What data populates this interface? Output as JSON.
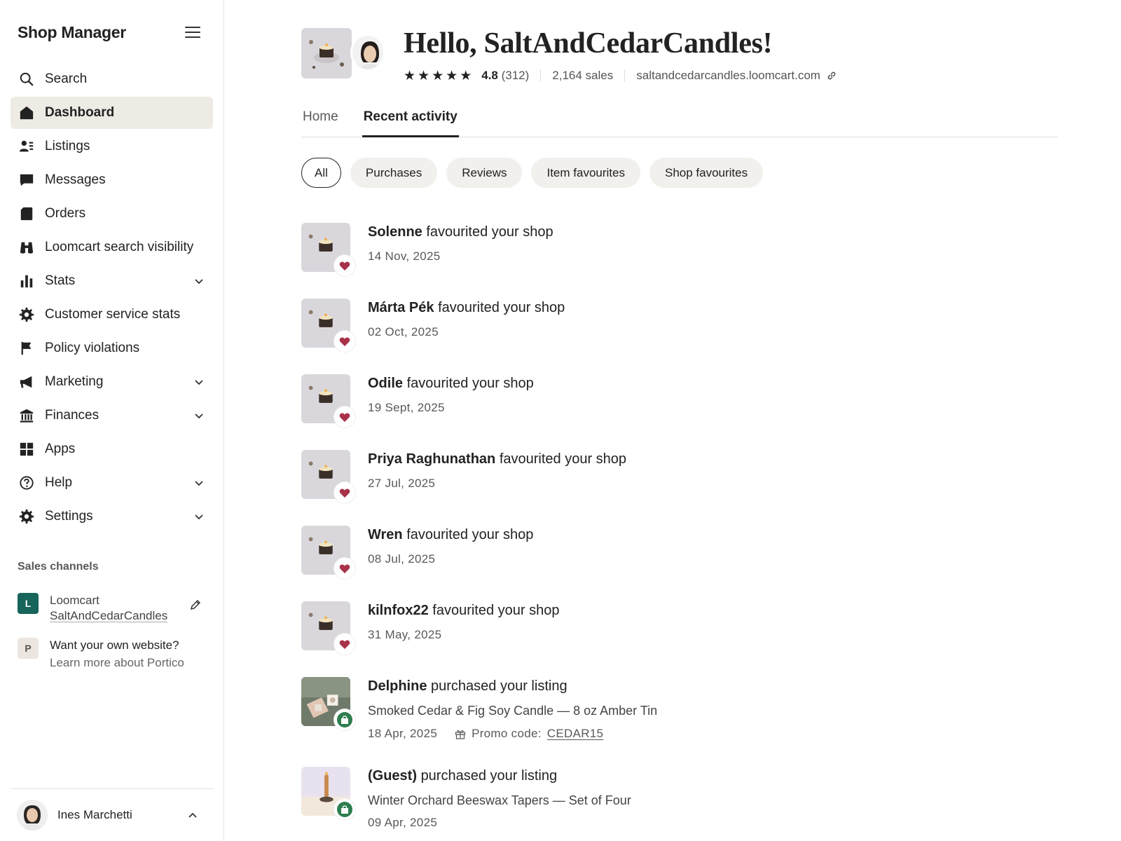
{
  "brand": "Shop Manager",
  "nav": [
    {
      "label": "Search",
      "icon": "search-icon"
    },
    {
      "label": "Dashboard",
      "icon": "home-icon",
      "active": true
    },
    {
      "label": "Listings",
      "icon": "listings-icon"
    },
    {
      "label": "Messages",
      "icon": "message-icon"
    },
    {
      "label": "Orders",
      "icon": "orders-icon"
    },
    {
      "label": "Loomcart search visibility",
      "icon": "binoculars-icon"
    },
    {
      "label": "Stats",
      "icon": "bar-chart-icon",
      "expandable": true
    },
    {
      "label": "Customer service stats",
      "icon": "gear-icon"
    },
    {
      "label": "Policy violations",
      "icon": "flag-icon"
    },
    {
      "label": "Marketing",
      "icon": "megaphone-icon",
      "expandable": true
    },
    {
      "label": "Finances",
      "icon": "bank-icon",
      "expandable": true
    },
    {
      "label": "Apps",
      "icon": "apps-grid-icon"
    },
    {
      "label": "Help",
      "icon": "help-icon",
      "expandable": true
    },
    {
      "label": "Settings",
      "icon": "settings-icon",
      "expandable": true
    }
  ],
  "sales_channels": {
    "title": "Sales channels",
    "loomcart": {
      "badge": "L",
      "name": "Loomcart",
      "shop": "SaltAndCedarCandles"
    },
    "portico": {
      "badge": "P",
      "line1": "Want your own website?",
      "line2": "Learn more about Portico"
    }
  },
  "user": {
    "name": "Ines Marchetti"
  },
  "header": {
    "greeting": "Hello, SaltAndCedarCandles!",
    "rating": "4.8",
    "rating_count": "(312)",
    "sales": "2,164 sales",
    "url": "saltandcedarcandles.loomcart.com",
    "stars": 5
  },
  "tabs": [
    {
      "label": "Home",
      "active": false
    },
    {
      "label": "Recent activity",
      "active": true
    }
  ],
  "filters": [
    {
      "label": "All",
      "active": true
    },
    {
      "label": "Purchases"
    },
    {
      "label": "Reviews"
    },
    {
      "label": "Item favourites"
    },
    {
      "label": "Shop favourites"
    }
  ],
  "activity": [
    {
      "name": "Solenne",
      "action": "favourited your shop",
      "date": "14 Nov, 2025",
      "type": "favourite"
    },
    {
      "name": "Márta Pék",
      "action": "favourited your shop",
      "date": "02 Oct, 2025",
      "type": "favourite"
    },
    {
      "name": "Odile",
      "action": "favourited your shop",
      "date": "19 Sept, 2025",
      "type": "favourite"
    },
    {
      "name": "Priya Raghunathan",
      "action": "favourited your shop",
      "date": "27 Jul, 2025",
      "type": "favourite"
    },
    {
      "name": "Wren",
      "action": "favourited your shop",
      "date": "08 Jul, 2025",
      "type": "favourite"
    },
    {
      "name": "kilnfox22",
      "action": "favourited your shop",
      "date": "31 May, 2025",
      "type": "favourite"
    },
    {
      "name": "Delphine",
      "action": "purchased your listing",
      "item": "Smoked Cedar & Fig Soy Candle — 8 oz Amber Tin",
      "date": "18 Apr, 2025",
      "promo_label": "Promo code:",
      "promo_code": "CEDAR15",
      "type": "purchase"
    },
    {
      "name": "(Guest)",
      "action": "purchased your listing",
      "item": "Winter Orchard Beeswax Tapers — Set of Four",
      "date": "09 Apr, 2025",
      "type": "purchase"
    }
  ],
  "colors": {
    "accent": "#222222",
    "active_nav_bg": "#eeebe5",
    "heart": "#a8324a",
    "purchase_badge": "#2e7d4f",
    "loomcart_badge": "#16645a"
  }
}
